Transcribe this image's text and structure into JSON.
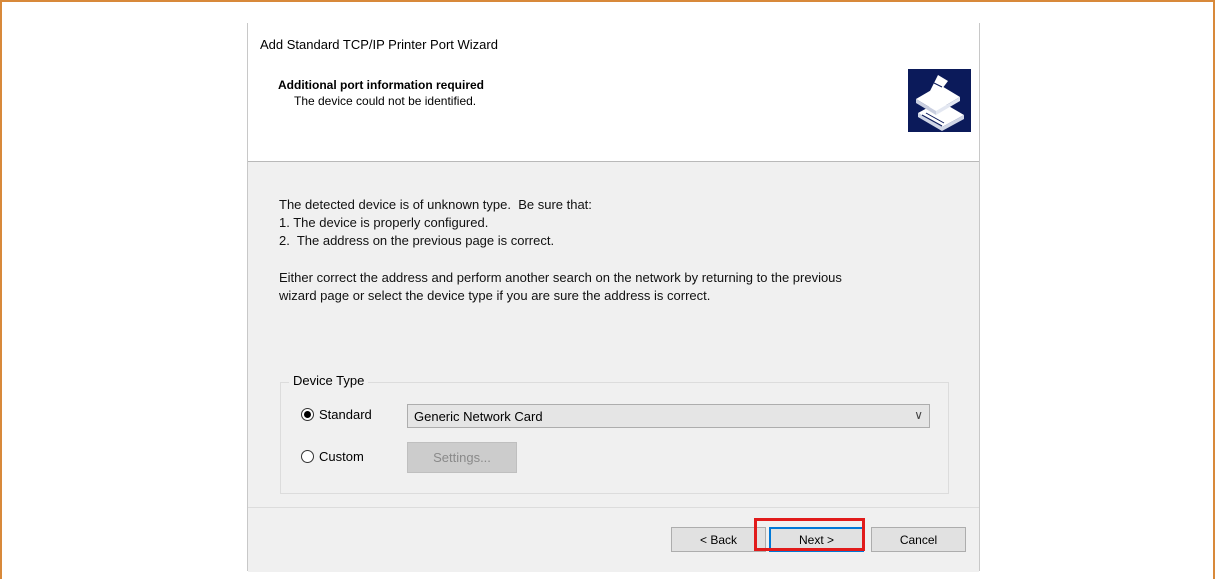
{
  "window": {
    "title": "Add Standard TCP/IP Printer Port Wizard"
  },
  "header": {
    "title": "Additional port information required",
    "subtitle": "The device could not be identified.",
    "logo_icon": "printer-icon"
  },
  "body": {
    "intro_line": "The detected device is of unknown type.  Be sure that:",
    "item1": "1. The device is properly configured.",
    "item2": "2.  The address on the previous page is correct.",
    "para_line1": "Either correct the address and perform another search on the network by returning to the previous",
    "para_line2": "wizard page or select the device type if you are sure the address is correct."
  },
  "device_type": {
    "label": "Device Type",
    "standard_label": "Standard",
    "standard_selected": true,
    "standard_value": "Generic Network Card",
    "custom_label": "Custom",
    "settings_label": "Settings..."
  },
  "footer": {
    "back_label": "< Back",
    "next_label": "Next >",
    "cancel_label": "Cancel"
  },
  "colors": {
    "frame_border": "#d8893a",
    "highlight": "#e11b1b",
    "logo_bg": "#0b1a5a"
  }
}
